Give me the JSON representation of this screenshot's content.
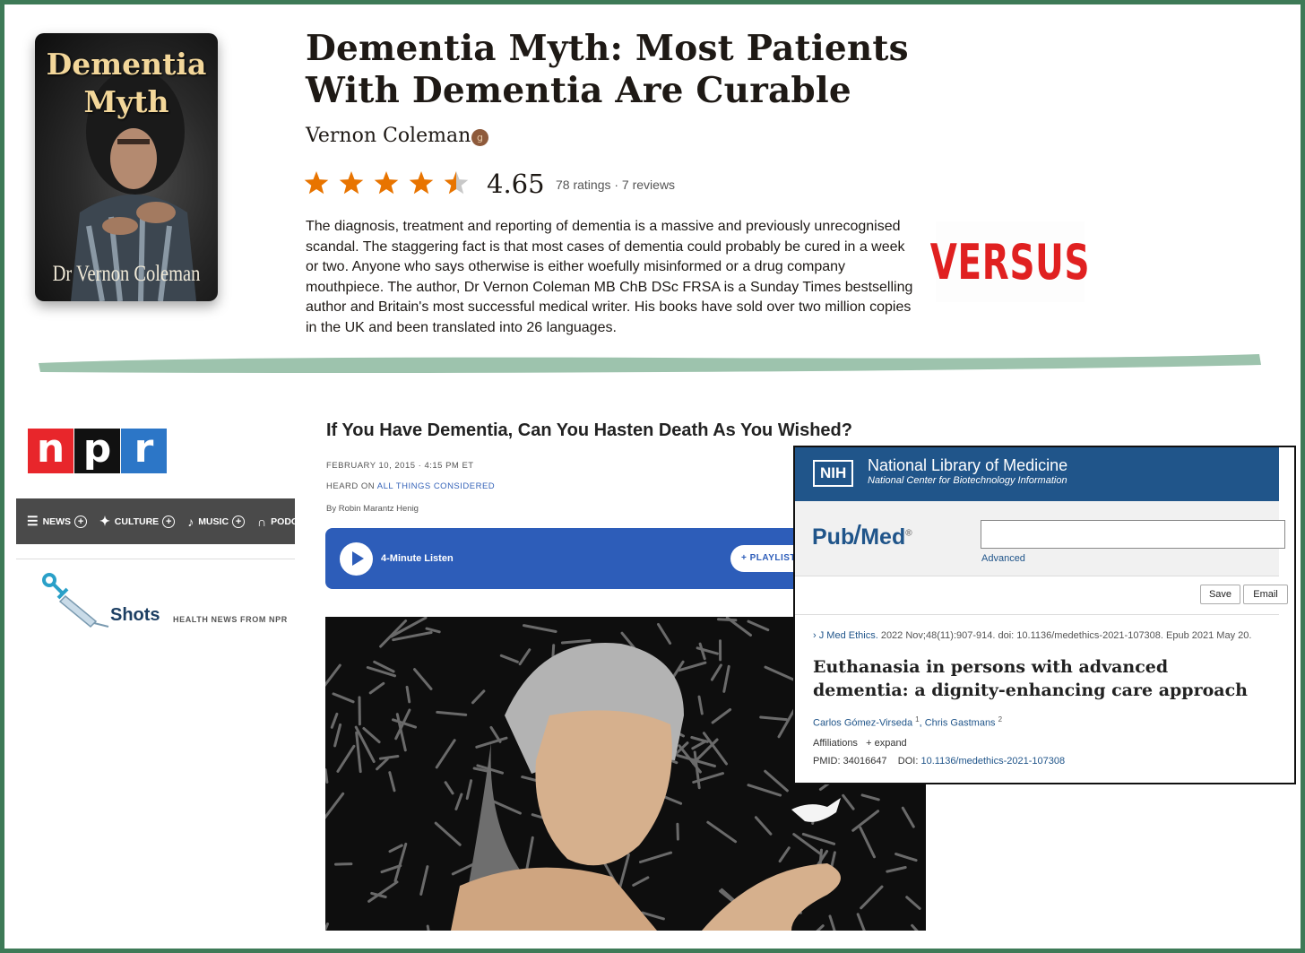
{
  "book": {
    "cover_title_line1": "Dementia",
    "cover_title_line2": "Myth",
    "cover_author": "Dr Vernon Coleman",
    "title": "Dementia Myth: Most Patients With Dementia Are Curable",
    "author": "Vernon Coleman",
    "author_badge": "g",
    "rating_stars": 4.65,
    "average_rating": "4.65",
    "ratings_text": "78 ratings · 7 reviews",
    "description": "The diagnosis, treatment and reporting of dementia is a massive and previously unrecognised scandal. The staggering fact is that most cases of dementia could probably be cured in a week or two. Anyone who says otherwise is either woefully misinformed or a drug company mouthpiece. The author, Dr Vernon Coleman MB ChB DSc FRSA is a Sunday Times bestselling author and Britain's most successful medical writer. His books have sold over two million copies in the UK and been translated into 26 languages.",
    "versus": "VERSUS"
  },
  "npr": {
    "logo": [
      "n",
      "p",
      "r"
    ],
    "logo_colors": [
      "#e8262b",
      "#111111",
      "#2c76c7"
    ],
    "nav": [
      {
        "icon": "news-icon",
        "label": "NEWS"
      },
      {
        "icon": "culture-icon",
        "label": "CULTURE"
      },
      {
        "icon": "music-icon",
        "label": "MUSIC"
      },
      {
        "icon": "podcast-icon",
        "label": "PODC"
      }
    ],
    "shots_label": "Shots",
    "shots_sub": "HEALTH NEWS FROM NPR",
    "headline": "If You Have Dementia, Can You Hasten Death As You Wished?",
    "date": "FEBRUARY 10, 2015 · 4:15 PM ET",
    "heard_on_prefix": "HEARD ON ",
    "heard_on_show": "ALL THINGS CONSIDERED",
    "byline": "By Robin Marantz Henig",
    "listen_label": "4-Minute Listen",
    "playlist_label": "+ PLAYLIST"
  },
  "pubmed": {
    "nih": "NIH",
    "nlm_title": "National Library of Medicine",
    "nlm_subtitle": "National Center for Biotechnology Information",
    "logo_pub": "Pub",
    "logo_med": "Med",
    "logo_reg": "®",
    "search_value": "",
    "advanced_label": "Advanced",
    "save_label": "Save",
    "email_label": "Email",
    "citation_journal": "J Med Ethics.",
    "citation_rest": " 2022 Nov;48(11):907-914. doi: 10.1136/medethics-2021-107308. Epub 2021 May 20.",
    "title": "Euthanasia in persons with advanced dementia: a dignity-enhancing care approach",
    "author1": "Carlos Gómez-Virseda",
    "author1_sup": "1",
    "author2": "Chris Gastmans",
    "author2_sup": "2",
    "affiliations_label": "Affiliations",
    "expand_label": "+ expand",
    "pmid_label": "PMID: 34016647",
    "doi_label": "DOI:",
    "doi_value": "10.1136/medethics-2021-107308"
  },
  "colors": {
    "frame": "#3e7a57",
    "star": "#e87400",
    "brush": "#9dc3ad",
    "npr_blue": "#2d5db9",
    "pubmed_blue": "#20558a",
    "versus_red": "#e02020"
  }
}
